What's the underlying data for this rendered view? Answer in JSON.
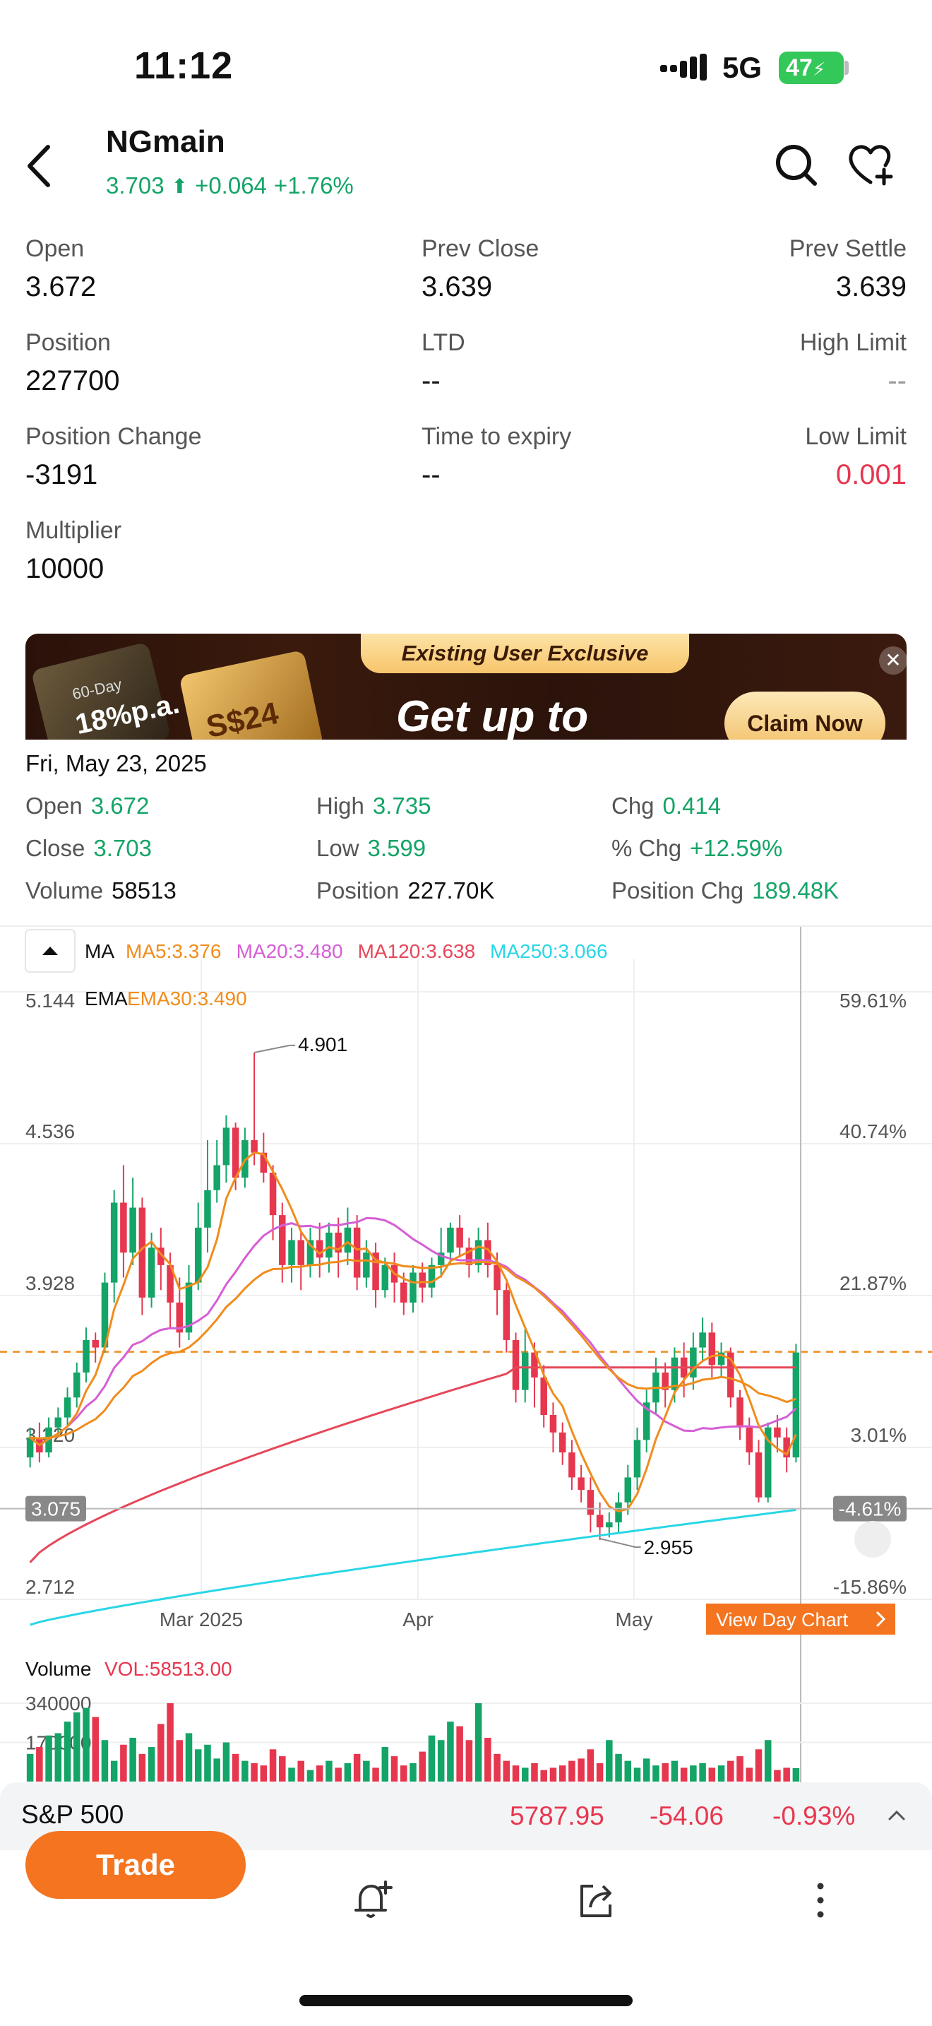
{
  "status_bar": {
    "time": "11:12",
    "network": "5G",
    "battery": "47"
  },
  "header": {
    "title": "NGmain",
    "price": "3.703",
    "change": "+0.064",
    "change_pct": "+1.76%",
    "icons": [
      "chevron-left-icon",
      "search-icon",
      "heart-plus-icon"
    ]
  },
  "stats": [
    {
      "label": "Open",
      "value": "3.672"
    },
    {
      "label": "Prev Close",
      "value": "3.639"
    },
    {
      "label": "Prev Settle",
      "value": "3.639"
    },
    {
      "label": "Position",
      "value": "227700"
    },
    {
      "label": "LTD",
      "value": "--"
    },
    {
      "label": "High Limit",
      "value": "--"
    },
    {
      "label": "Position Change",
      "value": "-3191"
    },
    {
      "label": "Time to expiry",
      "value": "--"
    },
    {
      "label": "Low Limit",
      "value": "0.001"
    },
    {
      "label": "Multiplier",
      "value": "10000"
    }
  ],
  "banner": {
    "tag": "Existing User Exclusive",
    "headline": "Get up to",
    "cta": "Claim Now",
    "rate_small": "60-Day",
    "rate": "18%p.a.",
    "cash": "S$24",
    "close": "✕"
  },
  "ohlc": {
    "date": "Fri, May 23, 2025",
    "rows": [
      [
        {
          "label": "Open",
          "value": "3.672"
        },
        {
          "label": "High",
          "value": "3.735"
        },
        {
          "label": "Chg",
          "value": "0.414"
        }
      ],
      [
        {
          "label": "Close",
          "value": "3.703"
        },
        {
          "label": "Low",
          "value": "3.599"
        },
        {
          "label": "% Chg",
          "value": "+12.59%"
        }
      ],
      [
        {
          "label": "Volume",
          "value": "58513"
        },
        {
          "label": "Position",
          "value": "227.70K"
        },
        {
          "label": "Position Chg",
          "value": "189.48K"
        }
      ]
    ]
  },
  "indicators": {
    "ma_label": "MA",
    "ma": [
      {
        "text": "MA5:3.376",
        "color": "#f08c1c"
      },
      {
        "text": "MA20:3.480",
        "color": "#d65ed6"
      },
      {
        "text": "MA120:3.638",
        "color": "#e6475a"
      },
      {
        "text": "MA250:3.066",
        "color": "#29d6e6"
      }
    ],
    "ema_label": "EMA",
    "ema": [
      {
        "text": "EMA30:3.490",
        "color": "#f08c1c"
      }
    ]
  },
  "chart_data": {
    "type": "candlestick",
    "y_left_ticks": [
      "5.144",
      "4.536",
      "3.928",
      "3.320",
      "2.712"
    ],
    "y_right_ticks": [
      "59.61%",
      "40.74%",
      "21.87%",
      "3.01%",
      "-15.86%"
    ],
    "ylim": [
      2.712,
      5.144
    ],
    "x_labels": [
      "Mar 2025",
      "Apr",
      "May"
    ],
    "current_price_line": 3.703,
    "crosshair": {
      "left_label": "3.075",
      "right_label": "-4.61%",
      "value": 3.075
    },
    "annotations": [
      {
        "text": "4.901",
        "value": 4.901
      },
      {
        "text": "2.955",
        "value": 2.955
      }
    ],
    "view_day_chart": "View Day Chart",
    "candles": [
      [
        3.28,
        3.36,
        3.24,
        3.4
      ],
      [
        3.36,
        3.3,
        3.26,
        3.42
      ],
      [
        3.3,
        3.4,
        3.28,
        3.44
      ],
      [
        3.4,
        3.44,
        3.36,
        3.48
      ],
      [
        3.44,
        3.52,
        3.4,
        3.56
      ],
      [
        3.52,
        3.62,
        3.48,
        3.66
      ],
      [
        3.62,
        3.75,
        3.58,
        3.8
      ],
      [
        3.75,
        3.72,
        3.66,
        3.78
      ],
      [
        3.72,
        3.98,
        3.7,
        4.02
      ],
      [
        3.98,
        4.3,
        3.9,
        4.35
      ],
      [
        4.3,
        4.1,
        4.0,
        4.45
      ],
      [
        4.1,
        4.28,
        4.05,
        4.4
      ],
      [
        4.28,
        3.92,
        3.85,
        4.32
      ],
      [
        3.92,
        4.12,
        3.88,
        4.18
      ],
      [
        4.12,
        4.05,
        3.95,
        4.2
      ],
      [
        4.05,
        3.9,
        3.8,
        4.1
      ],
      [
        3.9,
        3.78,
        3.72,
        4.0
      ],
      [
        3.78,
        3.98,
        3.75,
        4.05
      ],
      [
        3.98,
        4.2,
        3.95,
        4.3
      ],
      [
        4.2,
        4.35,
        4.1,
        4.55
      ],
      [
        4.35,
        4.45,
        4.3,
        4.55
      ],
      [
        4.45,
        4.6,
        4.38,
        4.65
      ],
      [
        4.6,
        4.4,
        4.35,
        4.62
      ],
      [
        4.4,
        4.55,
        4.36,
        4.6
      ],
      [
        4.55,
        4.5,
        4.45,
        4.9
      ],
      [
        4.5,
        4.42,
        4.38,
        4.58
      ],
      [
        4.42,
        4.25,
        4.15,
        4.45
      ],
      [
        4.25,
        4.05,
        3.98,
        4.3
      ],
      [
        4.05,
        4.15,
        3.98,
        4.2
      ],
      [
        4.15,
        4.05,
        3.95,
        4.18
      ],
      [
        4.05,
        4.15,
        4.0,
        4.2
      ],
      [
        4.15,
        4.08,
        4.0,
        4.22
      ],
      [
        4.08,
        4.18,
        4.02,
        4.22
      ],
      [
        4.18,
        4.1,
        4.0,
        4.24
      ],
      [
        4.1,
        4.2,
        4.05,
        4.28
      ],
      [
        4.2,
        4.0,
        3.95,
        4.25
      ],
      [
        4.0,
        4.1,
        3.96,
        4.15
      ],
      [
        4.1,
        3.95,
        3.88,
        4.14
      ],
      [
        3.95,
        4.05,
        3.92,
        4.08
      ],
      [
        4.05,
        3.98,
        3.9,
        4.1
      ],
      [
        3.98,
        3.9,
        3.85,
        4.02
      ],
      [
        3.9,
        4.02,
        3.86,
        4.05
      ],
      [
        4.02,
        3.96,
        3.9,
        4.06
      ],
      [
        3.96,
        4.05,
        3.92,
        4.08
      ],
      [
        4.05,
        4.1,
        4.0,
        4.2
      ],
      [
        4.1,
        4.2,
        4.05,
        4.22
      ],
      [
        4.2,
        4.12,
        4.08,
        4.25
      ],
      [
        4.12,
        4.05,
        4.0,
        4.16
      ],
      [
        4.05,
        4.15,
        4.02,
        4.2
      ],
      [
        4.15,
        4.05,
        4.0,
        4.22
      ],
      [
        4.05,
        3.95,
        3.85,
        4.1
      ],
      [
        3.95,
        3.75,
        3.7,
        3.98
      ],
      [
        3.75,
        3.55,
        3.5,
        3.78
      ],
      [
        3.55,
        3.7,
        3.5,
        3.8
      ],
      [
        3.7,
        3.6,
        3.48,
        3.74
      ],
      [
        3.6,
        3.45,
        3.4,
        3.65
      ],
      [
        3.45,
        3.38,
        3.3,
        3.5
      ],
      [
        3.38,
        3.3,
        3.25,
        3.42
      ],
      [
        3.3,
        3.2,
        3.15,
        3.35
      ],
      [
        3.2,
        3.15,
        3.1,
        3.25
      ],
      [
        3.15,
        3.05,
        2.98,
        3.2
      ],
      [
        3.05,
        3.0,
        2.95,
        3.1
      ],
      [
        3.0,
        3.02,
        2.96,
        3.06
      ],
      [
        3.02,
        3.1,
        2.98,
        3.14
      ],
      [
        3.1,
        3.2,
        3.05,
        3.25
      ],
      [
        3.2,
        3.35,
        3.15,
        3.4
      ],
      [
        3.35,
        3.5,
        3.3,
        3.55
      ],
      [
        3.5,
        3.62,
        3.45,
        3.68
      ],
      [
        3.62,
        3.55,
        3.48,
        3.66
      ],
      [
        3.55,
        3.68,
        3.5,
        3.72
      ],
      [
        3.68,
        3.6,
        3.52,
        3.74
      ],
      [
        3.6,
        3.72,
        3.55,
        3.78
      ],
      [
        3.72,
        3.78,
        3.66,
        3.84
      ],
      [
        3.78,
        3.65,
        3.6,
        3.82
      ],
      [
        3.65,
        3.7,
        3.6,
        3.74
      ],
      [
        3.7,
        3.52,
        3.48,
        3.72
      ],
      [
        3.52,
        3.4,
        3.35,
        3.55
      ],
      [
        3.4,
        3.3,
        3.25,
        3.44
      ],
      [
        3.3,
        3.12,
        3.1,
        3.35
      ],
      [
        3.12,
        3.4,
        3.1,
        3.42
      ],
      [
        3.4,
        3.36,
        3.3,
        3.45
      ],
      [
        3.36,
        3.28,
        3.22,
        3.4
      ],
      [
        3.28,
        3.7,
        3.26,
        3.735
      ]
    ]
  },
  "volume": {
    "label": "Volume",
    "vol_text": "VOL:58513.00",
    "ticks": [
      "340000",
      "170000"
    ],
    "max": 380000,
    "bars": [
      120000,
      150000,
      200000,
      210000,
      260000,
      300000,
      320000,
      280000,
      180000,
      90000,
      160000,
      190000,
      120000,
      150000,
      250000,
      340000,
      180000,
      210000,
      140000,
      160000,
      100000,
      170000,
      120000,
      90000,
      80000,
      70000,
      140000,
      110000,
      60000,
      90000,
      50000,
      70000,
      90000,
      60000,
      80000,
      120000,
      90000,
      60000,
      150000,
      110000,
      70000,
      80000,
      130000,
      200000,
      180000,
      260000,
      240000,
      180000,
      340000,
      190000,
      120000,
      90000,
      70000,
      60000,
      80000,
      50000,
      60000,
      70000,
      90000,
      100000,
      140000,
      80000,
      180000,
      120000,
      90000,
      60000,
      100000,
      70000,
      80000,
      90000,
      60000,
      70000,
      80000,
      60000,
      70000,
      90000,
      110000,
      60000,
      140000,
      180000,
      50000,
      60000,
      58513
    ]
  },
  "index_bar": {
    "name": "S&P 500",
    "value": "5787.95",
    "change": "-54.06",
    "change_pct": "-0.93%"
  },
  "bottom_bar": {
    "trade": "Trade"
  }
}
